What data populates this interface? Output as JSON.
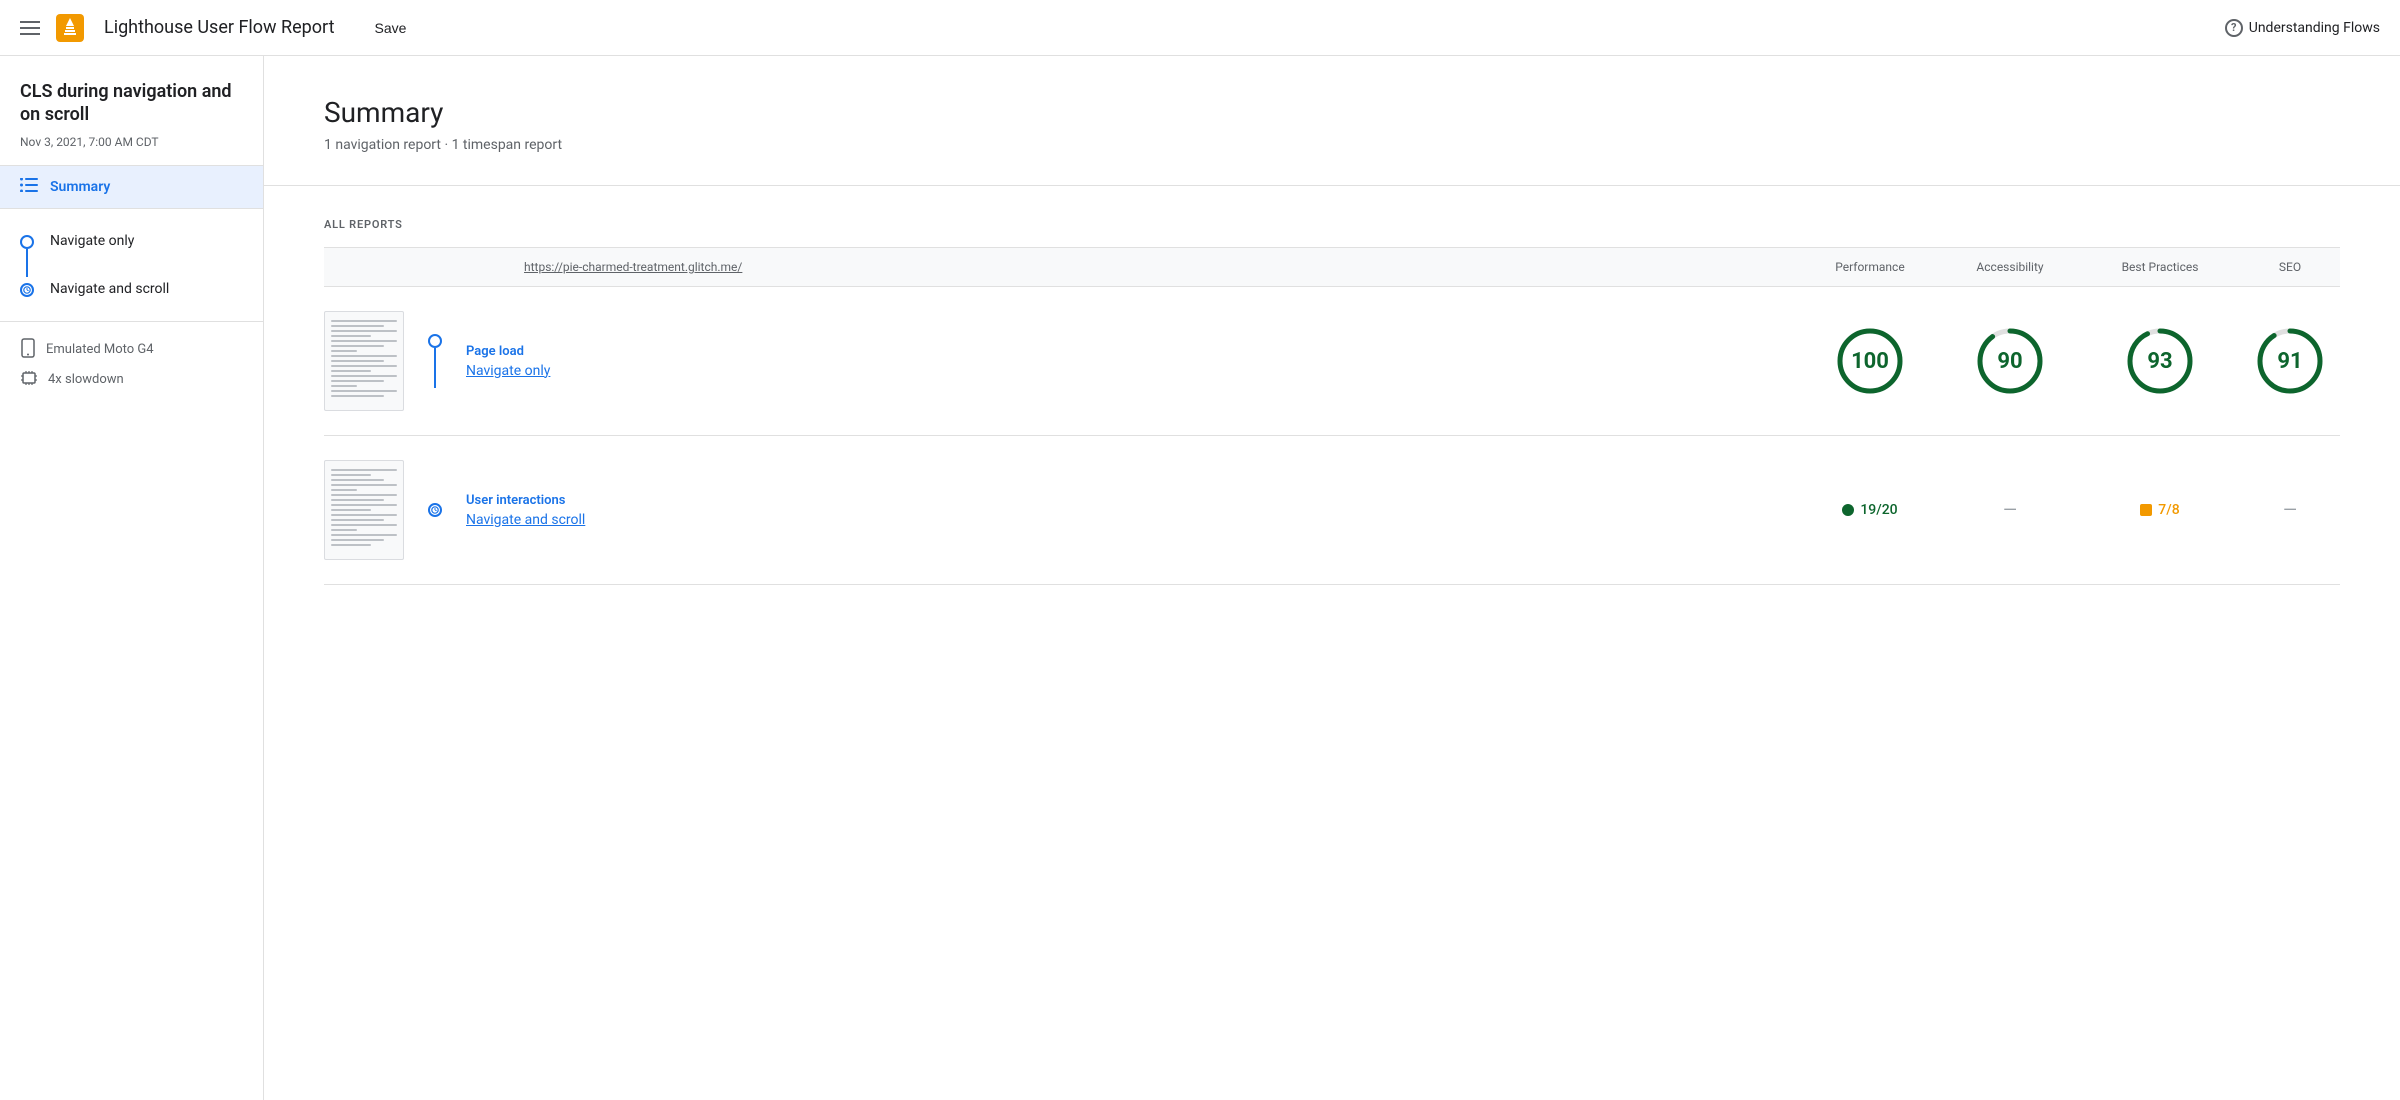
{
  "header": {
    "menu_label": "menu",
    "title": "Lighthouse User Flow Report",
    "save_label": "Save",
    "understanding_flows_label": "Understanding Flows",
    "help_label": "?"
  },
  "sidebar": {
    "flow_title": "CLS during navigation and on scroll",
    "flow_date": "Nov 3, 2021, 7:00 AM CDT",
    "summary_label": "Summary",
    "nav_items": [
      {
        "label": "Navigate only",
        "type": "circle"
      },
      {
        "label": "Navigate and scroll",
        "type": "clock"
      }
    ],
    "device_items": [
      {
        "label": "Emulated Moto G4",
        "icon": "📱"
      },
      {
        "label": "4x slowdown",
        "icon": "⚙"
      }
    ]
  },
  "main": {
    "summary_title": "Summary",
    "summary_subtitle": "1 navigation report · 1 timespan report",
    "all_reports_label": "ALL REPORTS",
    "table_headers": {
      "url": "https://pie-charmed-treatment.glitch.me/",
      "performance": "Performance",
      "accessibility": "Accessibility",
      "best_practices": "Best Practices",
      "seo": "SEO"
    },
    "reports": [
      {
        "type": "Page load",
        "name": "Navigate only",
        "timeline_type": "circle",
        "scores": {
          "performance": {
            "type": "circle",
            "value": 100,
            "color": "#0d652d"
          },
          "accessibility": {
            "type": "circle",
            "value": 90,
            "color": "#0d652d"
          },
          "best_practices": {
            "type": "circle",
            "value": 93,
            "color": "#0d652d"
          },
          "seo": {
            "type": "circle",
            "value": 91,
            "color": "#0d652d"
          }
        }
      },
      {
        "type": "User interactions",
        "name": "Navigate and scroll",
        "timeline_type": "clock",
        "scores": {
          "performance": {
            "type": "badge",
            "value": "19/20",
            "color": "green"
          },
          "accessibility": {
            "type": "dash"
          },
          "best_practices": {
            "type": "badge-square",
            "value": "7/8",
            "color": "orange"
          },
          "seo": {
            "type": "dash"
          }
        }
      }
    ]
  },
  "colors": {
    "blue": "#1a73e8",
    "green": "#0d652d",
    "orange": "#f29900",
    "border": "#e0e0e0",
    "bg_selected": "#e8f0fe",
    "text_secondary": "#5f6368"
  }
}
